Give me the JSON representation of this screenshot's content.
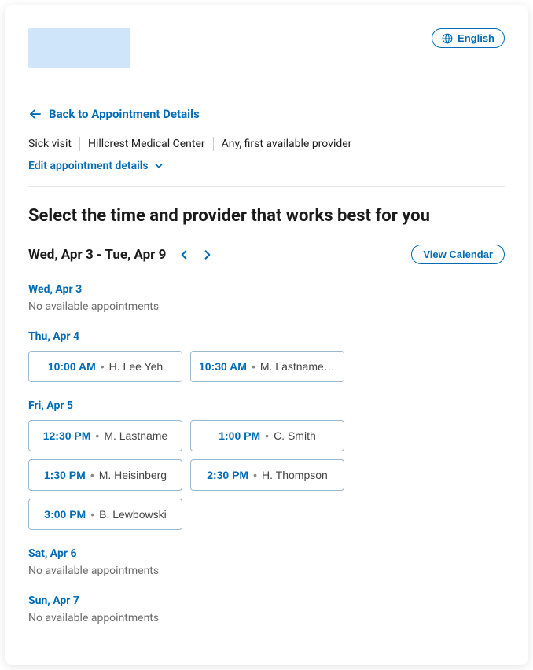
{
  "language": {
    "label": "English"
  },
  "back": {
    "label": "Back to Appointment Details"
  },
  "meta": {
    "visit_type": "Sick visit",
    "location": "Hillcrest Medical Center",
    "provider_pref": "Any, first available provider"
  },
  "edit": {
    "label": "Edit appointment details"
  },
  "title": "Select the time and provider that works best for you",
  "range": {
    "label": "Wed, Apr 3 - Tue, Apr 9"
  },
  "view_calendar": {
    "label": "View Calendar"
  },
  "no_appointments_text": "No available appointments",
  "days": [
    {
      "label": "Wed, Apr 3",
      "slots": []
    },
    {
      "label": "Thu, Apr 4",
      "slots": [
        {
          "time": "10:00 AM",
          "provider": "H. Lee Yeh"
        },
        {
          "time": "10:30 AM",
          "provider": "M. Lastnamereal..."
        }
      ]
    },
    {
      "label": "Fri, Apr 5",
      "slots": [
        {
          "time": "12:30 PM",
          "provider": "M. Lastname"
        },
        {
          "time": "1:00 PM",
          "provider": "C. Smith"
        },
        {
          "time": "1:30 PM",
          "provider": "M. Heisinberg"
        },
        {
          "time": "2:30 PM",
          "provider": "H. Thompson"
        },
        {
          "time": "3:00 PM",
          "provider": "B. Lewbowski"
        }
      ]
    },
    {
      "label": "Sat, Apr 6",
      "slots": []
    },
    {
      "label": "Sun, Apr 7",
      "slots": []
    }
  ]
}
